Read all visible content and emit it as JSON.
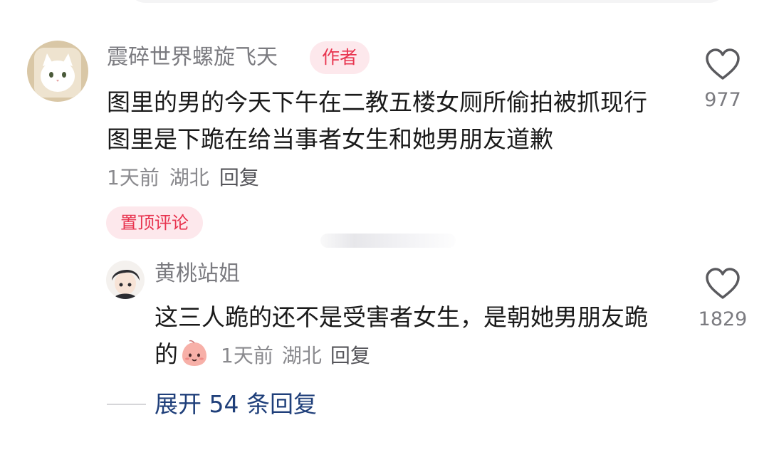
{
  "top_comment": {
    "username": "震碎世界螺旋飞天",
    "author_badge": "作者",
    "text": "图里的男的今天下午在二教五楼女厕所偷拍被抓现行 图里是下跪在给当事者女生和她男朋友道歉",
    "time": "1天前",
    "location": "湖北",
    "reply_label": "回复",
    "like_count": "977",
    "pinned_label": "置顶评论",
    "avatar_icon": "white-cat-in-toast-avatar"
  },
  "reply_comment": {
    "username": "黄桃站姐",
    "text": "这三人跪的还不是受害者女生，是朝她男朋友跪的",
    "emoji_icon": "peach-face-emoji",
    "time": "1天前",
    "location": "湖北",
    "reply_label": "回复",
    "like_count": "1829",
    "avatar_icon": "anime-boy-avatar"
  },
  "expand_replies": "展开 54 条回复",
  "colors": {
    "badge_bg": "#fde8ec",
    "badge_text": "#e8344f",
    "link": "#1f3f7a",
    "muted": "#8a8a8e"
  }
}
